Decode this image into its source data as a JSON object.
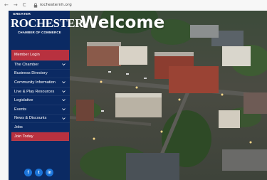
{
  "browser": {
    "back": "←",
    "forward": "→",
    "reload": "C",
    "url": "rochesternh.org"
  },
  "hero": {
    "title": "Welcome"
  },
  "logo": {
    "line1": "GREATER",
    "line2": "ROCHESTER",
    "line3": "CHAMBER OF COMMERCE"
  },
  "menu": [
    {
      "label": "Member Login",
      "highlight": true,
      "chevron": false
    },
    {
      "label": "The Chamber",
      "highlight": false,
      "chevron": true
    },
    {
      "label": "Business Directory",
      "highlight": false,
      "chevron": false
    },
    {
      "label": "Community Information",
      "highlight": false,
      "chevron": true
    },
    {
      "label": "Live & Play Resources",
      "highlight": false,
      "chevron": true
    },
    {
      "label": "Legislative",
      "highlight": false,
      "chevron": true
    },
    {
      "label": "Events",
      "highlight": false,
      "chevron": true
    },
    {
      "label": "News & Discounts",
      "highlight": false,
      "chevron": true
    },
    {
      "label": "Jobs",
      "highlight": false,
      "chevron": false
    },
    {
      "label": "Join Today",
      "highlight": true,
      "chevron": false
    }
  ],
  "social": {
    "facebook": "f",
    "twitter": "t",
    "linkedin": "in"
  },
  "colors": {
    "sidebar": "#0b2a63",
    "highlight": "#b8313f",
    "social": "#1b74d9"
  }
}
